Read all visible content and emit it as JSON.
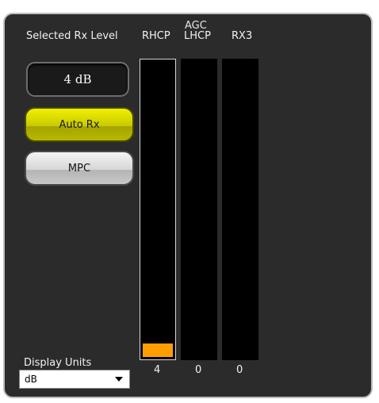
{
  "group_title": "AGC",
  "selected_level": {
    "label": "Selected Rx Level",
    "value": "4 dB"
  },
  "buttons": {
    "auto_rx": "Auto Rx",
    "mpc": "MPC"
  },
  "channels": [
    {
      "name": "RHCP",
      "value": "4",
      "level_fraction": 0.045,
      "selected": true
    },
    {
      "name": "LHCP",
      "value": "0",
      "level_fraction": 0,
      "selected": false
    },
    {
      "name": "RX3",
      "value": "0",
      "level_fraction": 0,
      "selected": false
    }
  ],
  "display_units": {
    "label": "Display Units",
    "selected": "dB"
  },
  "colors": {
    "panel_bg": "#2b2b2b",
    "auto_rx_active": "#d6d600",
    "level_bar": "#ff9e00"
  }
}
